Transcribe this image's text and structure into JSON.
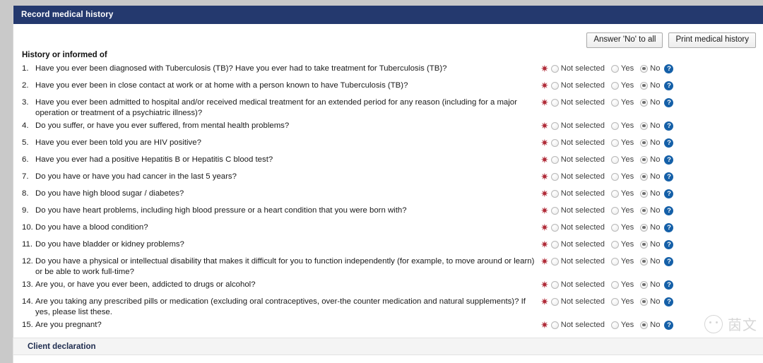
{
  "panel": {
    "title": "Record medical history"
  },
  "toolbar": {
    "answer_no_to_all_label": "Answer 'No' to all",
    "print_label": "Print medical history"
  },
  "section": {
    "title": "History or informed of"
  },
  "answer_options": {
    "required_marker": "✷",
    "not_selected_label": "Not selected",
    "yes_label": "Yes",
    "no_label": "No",
    "help_label": "?",
    "selected_value": "No"
  },
  "colors": {
    "header_blue": "#24396e",
    "required_red": "#b02a37",
    "help_blue": "#1560a8",
    "declaration_title": "#1e2c4f"
  },
  "questions": [
    {
      "num": "1.",
      "text": "Have you ever been diagnosed with Tuberculosis (TB)? Have you ever had to take treatment for Tuberculosis (TB)?",
      "selected": "No"
    },
    {
      "num": "2.",
      "text": "Have you ever been in close contact at work or at home with a person known to have Tuberculosis (TB)?",
      "selected": "No"
    },
    {
      "num": "3.",
      "text": "Have you ever been admitted to hospital and/or received medical treatment for an extended period for any reason (including for a major operation or treatment of a psychiatric illness)?",
      "selected": "No"
    },
    {
      "num": "4.",
      "text": "Do you suffer, or have you ever suffered, from mental health problems?",
      "selected": "No"
    },
    {
      "num": "5.",
      "text": "Have you ever been told you are HIV positive?",
      "selected": "No"
    },
    {
      "num": "6.",
      "text": "Have you ever had a positive Hepatitis B or Hepatitis C blood test?",
      "selected": "No"
    },
    {
      "num": "7.",
      "text": "Do you have or have you had cancer in the last 5 years?",
      "selected": "No"
    },
    {
      "num": "8.",
      "text": "Do you have high blood sugar / diabetes?",
      "selected": "No"
    },
    {
      "num": "9.",
      "text": "Do you have heart problems, including high blood pressure or a heart condition that you were born with?",
      "selected": "No"
    },
    {
      "num": "10.",
      "text": "Do you have a blood condition?",
      "selected": "No"
    },
    {
      "num": "11.",
      "text": "Do you have bladder or kidney problems?",
      "selected": "No"
    },
    {
      "num": "12.",
      "text": "Do you have a physical or intellectual disability that makes it difficult for you to function independently (for example, to move around or learn) or be able to work full-time?",
      "selected": "No"
    },
    {
      "num": "13.",
      "text": "Are you, or have you ever been, addicted to drugs or alcohol?",
      "selected": "No"
    },
    {
      "num": "14.",
      "text": "Are you taking any prescribed pills or medication (excluding oral contraceptives, over-the counter medication and natural supplements)? If yes, please list these.",
      "selected": "No"
    },
    {
      "num": "15.",
      "text": "Are you pregnant?",
      "selected": "No"
    }
  ],
  "declaration": {
    "title": "Client declaration"
  },
  "watermark": {
    "text": "茵文",
    "icon": "wechat-smiley-icon"
  }
}
